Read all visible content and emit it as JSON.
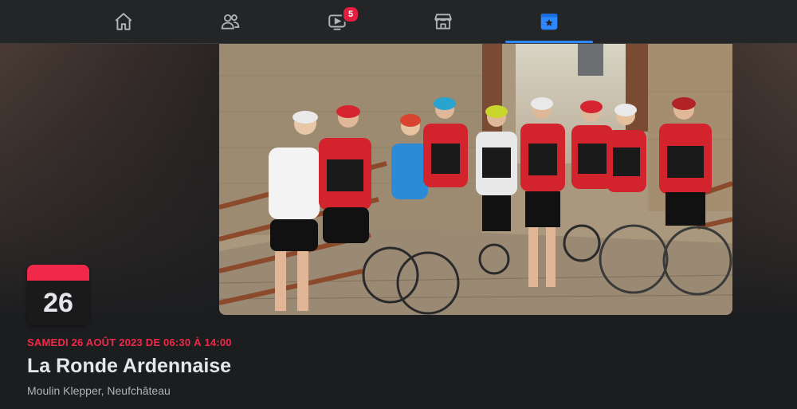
{
  "nav": {
    "items": [
      {
        "icon": "home-icon",
        "label": "Home"
      },
      {
        "icon": "friends-icon",
        "label": "Friends"
      },
      {
        "icon": "video-icon",
        "label": "Watch",
        "badge": "5"
      },
      {
        "icon": "marketplace-icon",
        "label": "Marketplace"
      },
      {
        "icon": "events-icon",
        "label": "Events",
        "active": true
      }
    ],
    "badge_color": "#e41e3f",
    "active_color": "#2d88ff"
  },
  "event": {
    "day": "26",
    "date_line": "SAMEDI 26 AOÛT 2023 DE 06:30 À 14:00",
    "title": "La Ronde Ardennaise",
    "location": "Moulin Klepper, Neufchâteau",
    "accent_color": "#f02849"
  }
}
